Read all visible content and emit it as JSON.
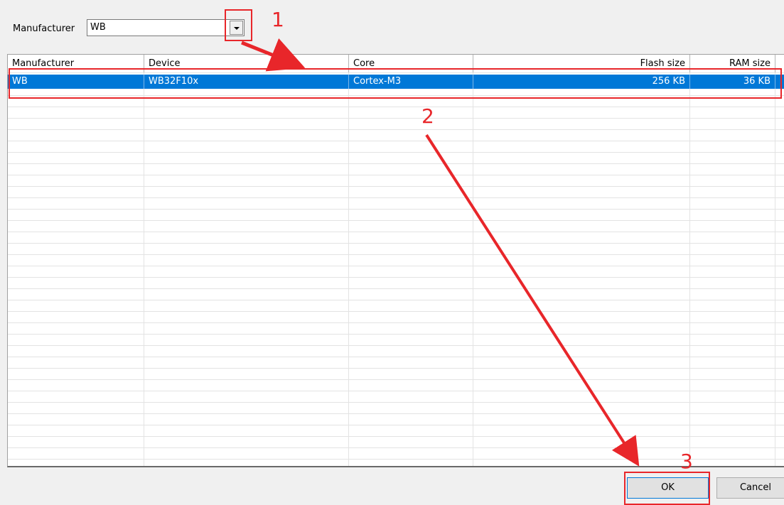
{
  "manufacturer_filter": {
    "label": "Manufacturer",
    "value": "WB"
  },
  "table": {
    "columns": [
      "Manufacturer",
      "Device",
      "Core",
      "Flash size",
      "RAM size"
    ],
    "rows": [
      {
        "manufacturer": "WB",
        "device": "WB32F10x",
        "core": "Cortex-M3",
        "flash": "256 KB",
        "ram": "36 KB"
      }
    ]
  },
  "buttons": {
    "ok": "OK",
    "cancel": "Cancel"
  },
  "annotations": {
    "step1": "1",
    "step2": "2",
    "step3": "3",
    "color": "#e8262a"
  },
  "colors": {
    "selection": "#0078d7"
  }
}
